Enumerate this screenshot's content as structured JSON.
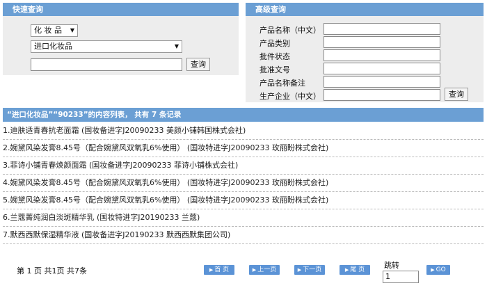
{
  "quick_search": {
    "title": "快速查询",
    "category": "化 妆 品",
    "subcategory": "进口化妆品",
    "input_value": "",
    "button": "查询"
  },
  "advanced_search": {
    "title": "高级查询",
    "fields": [
      {
        "label": "产品名称（中文）",
        "value": ""
      },
      {
        "label": "产品类别",
        "value": ""
      },
      {
        "label": "批件状态",
        "value": ""
      },
      {
        "label": "批准文号",
        "value": ""
      },
      {
        "label": "产品名称备注",
        "value": ""
      },
      {
        "label": "生产企业（中文）",
        "value": ""
      }
    ],
    "button": "查询"
  },
  "results": {
    "header": "“进口化妆品”“90233”的内容列表， 共有 7 条记录",
    "items": [
      "1.迪肤适青春抗老面霜 (国妆备进字J20090233 美颜小铺韩国株式会社)",
      "2.婉黛风染发膏8.45号（配合婉黛风双氧乳6%使用） (国妆特进字J20090233 玫丽盼株式会社)",
      "3.菲诗小铺青春焕颜面霜 (国妆备进字J20090233 菲诗小铺株式会社)",
      "4.婉黛风染发膏8.45号（配合婉黛风双氧乳6%使用） (国妆特进字J20090233 玫丽盼株式会社)",
      "5.婉黛风染发膏8.45号（配合婉黛风双氧乳6%使用） (国妆特进字J20090233 玫丽盼株式会社)",
      "6.兰蔻菁纯润白淡斑精华乳 (国妆特进字J20190233 兰蔻)",
      "7.默西西默保湿精华液 (国妆备进字J20190233 默西西默集团公司)"
    ]
  },
  "pager": {
    "summary": "第 1 页 共1页 共7条",
    "first": "首 页",
    "prev": "上一页",
    "next": "下一页",
    "last": "尾 页",
    "jump_label": "跳转",
    "jump_value": "1",
    "go": "GO"
  },
  "colors": {
    "header_bg": "#6b9fd4",
    "panel_bg": "#ededed",
    "pager_button": "#5b93d6"
  },
  "icons": {
    "dropdown": "chevron-down-icon",
    "pager_arrow": "arrow-right-icon"
  }
}
